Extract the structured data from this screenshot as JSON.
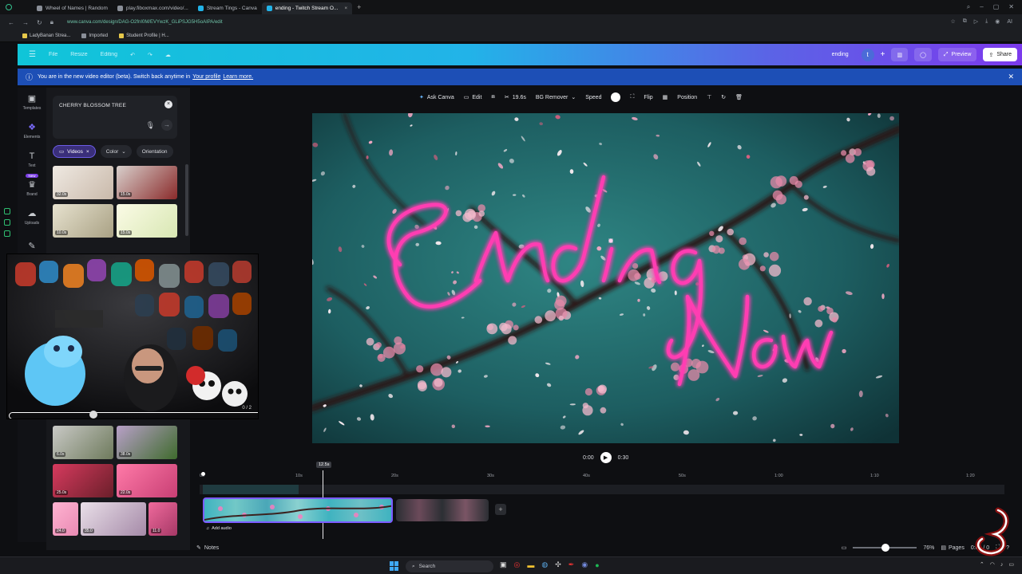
{
  "browser": {
    "tabs": [
      "Wheel of Names | Random",
      "play.fiboxmax.com/video/...",
      "Stream Tings - Canva",
      "ending - Twitch Stream O..."
    ],
    "active_tab_index": 3,
    "url": "www.canva.com/design/DAG-O2fnI0M/EVYwzK_GLiPSJG5H5oAIPA/edit",
    "bookmarks": [
      "LadyBanan Strea...",
      "Imported",
      "Student Profile | H..."
    ]
  },
  "canva_header": {
    "menu": [
      "File",
      "Resize",
      "Editing"
    ],
    "design_name": "ending",
    "avatar_letter": "t",
    "preview_label": "Preview",
    "share_label": "Share"
  },
  "banner": {
    "text": "You are in the new video editor (beta). Switch back anytime in",
    "link1": "Your profile",
    "link2": "Learn more."
  },
  "rail": {
    "items": [
      {
        "label": "Templates",
        "icon": "templates-icon",
        "glyph": "▣"
      },
      {
        "label": "Elements",
        "icon": "elements-icon",
        "glyph": "❖"
      },
      {
        "label": "Text",
        "icon": "text-icon",
        "glyph": "T"
      },
      {
        "label": "Brand",
        "icon": "brand-icon",
        "glyph": "♛"
      },
      {
        "label": "Uploads",
        "icon": "uploads-icon",
        "glyph": "☁"
      },
      {
        "label": "Draw",
        "icon": "draw-icon",
        "glyph": "✎"
      }
    ],
    "new_badge": "New"
  },
  "panel": {
    "search_value": "CHERRY BLOSSOM TREE",
    "chips": [
      "Videos",
      "Color",
      "Orientation"
    ],
    "thumbs": [
      {
        "dur": "32.0s",
        "colors": [
          "#efe9e2",
          "#c9b9aa"
        ]
      },
      {
        "dur": "15.0s",
        "colors": [
          "#d8d0cc",
          "#8a2a2a"
        ]
      },
      {
        "dur": "10.0s",
        "colors": [
          "#e7e2cf",
          "#a9a184"
        ]
      },
      {
        "dur": "15.0s",
        "colors": [
          "#fbfbe6",
          "#d8e7b3"
        ]
      },
      {
        "dur": "6.0s",
        "colors": [
          "#c9c9c6",
          "#6e7a5c"
        ]
      },
      {
        "dur": "38.0s",
        "colors": [
          "#b8a0c8",
          "#3f6b2d"
        ]
      },
      {
        "dur": "25.0s",
        "colors": [
          "#d63a5e",
          "#6b1f2a"
        ]
      },
      {
        "dur": "22.0s",
        "colors": [
          "#ff7aa8",
          "#c83f74"
        ]
      },
      {
        "dur": "24.0",
        "colors": [
          "#ffb3d1",
          "#e98ab3"
        ]
      },
      {
        "dur": "35.0",
        "colors": [
          "#e9dfe8",
          "#a58aa8"
        ]
      },
      {
        "dur": "11.0",
        "colors": [
          "#ef6a9c",
          "#a63866"
        ]
      }
    ],
    "webcam_counter": "0 / 2"
  },
  "canvas_toolbar": {
    "ask_canva": "Ask Canva",
    "edit": "Edit",
    "duration": "19.6s",
    "bg_remover": "BG Remover",
    "speed": "Speed",
    "flip": "Flip",
    "position": "Position"
  },
  "canvas_art": {
    "word1": "Ending",
    "word2": "Now"
  },
  "playback": {
    "current": "0:00",
    "total": "0:30"
  },
  "timeline": {
    "marker": "12.5s",
    "ticks": [
      "0s",
      "10s",
      "20s",
      "30s",
      "40s",
      "50s",
      "1:00",
      "1:10",
      "1:20"
    ],
    "add_audio": "Add audio",
    "notes": "Notes",
    "zoom": "76%",
    "pages": "Pages",
    "time_readout": "0:00 / 0"
  },
  "taskbar": {
    "search": "Search"
  },
  "colors": {
    "accent": "#7c3aed",
    "banner": "#1d4fb6",
    "header_start": "#10c5d8",
    "neon": "#ff2fa8"
  }
}
